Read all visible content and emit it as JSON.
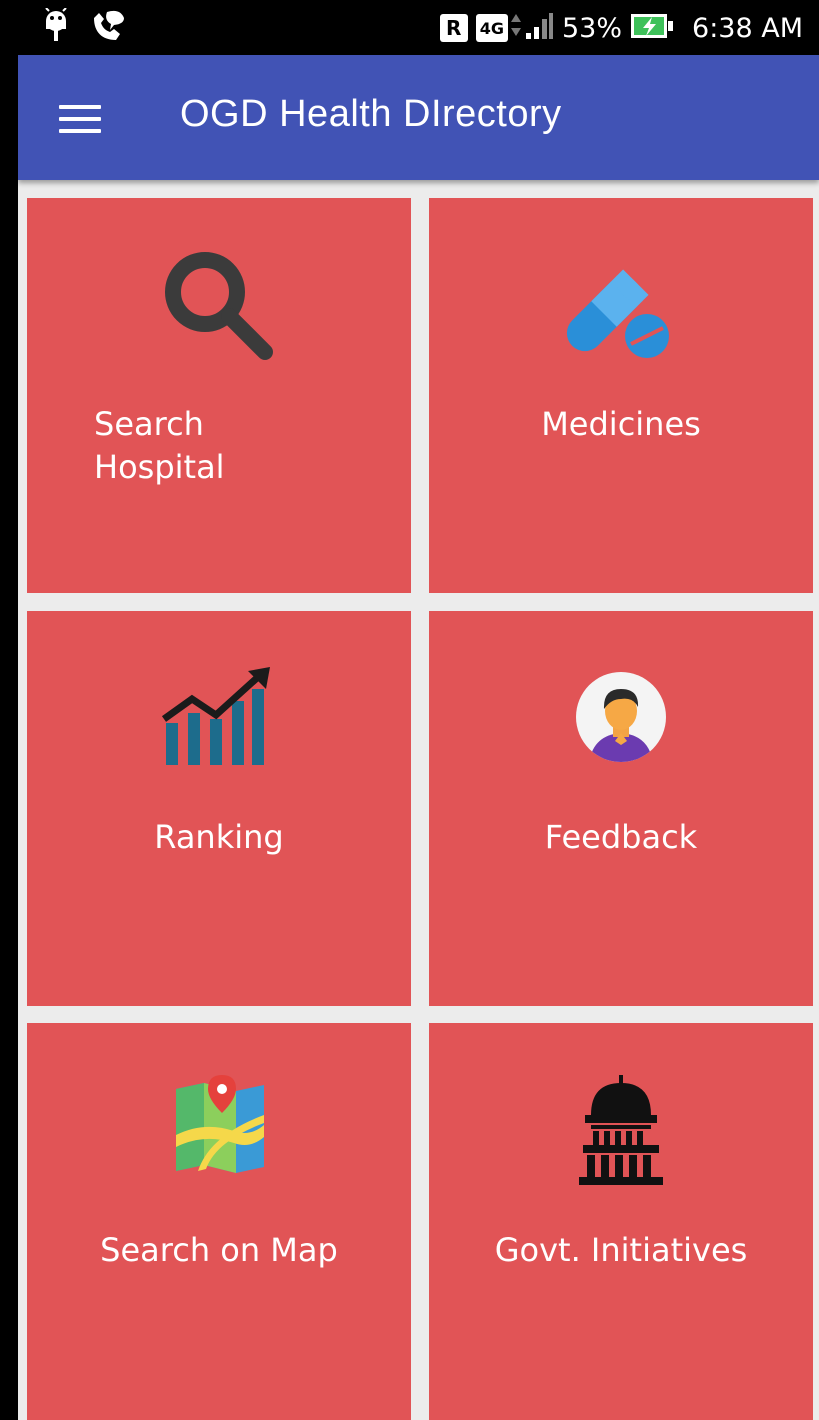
{
  "status_bar": {
    "roaming_badge": "R",
    "network_type": "4G",
    "battery_percent": "53%",
    "time": "6:38 AM",
    "icons": [
      "android-icon",
      "wifi-call-icon",
      "signal-icon",
      "battery-charging-icon"
    ]
  },
  "toolbar": {
    "title": "OGD Health DIrectory",
    "menu_icon": "hamburger-menu-icon"
  },
  "tiles": [
    {
      "label": "Search Hospital",
      "label_line1": "Search",
      "label_line2": "Hospital",
      "icon": "magnifier-icon"
    },
    {
      "label": "Medicines",
      "icon": "pills-icon"
    },
    {
      "label": "Ranking",
      "icon": "bar-chart-trend-icon"
    },
    {
      "label": "Feedback",
      "icon": "user-avatar-icon"
    },
    {
      "label": "Search on Map",
      "icon": "map-pin-icon"
    },
    {
      "label": "Govt. Initiatives",
      "icon": "government-building-icon"
    }
  ],
  "colors": {
    "toolbar": "#4153b5",
    "tile": "#e15456",
    "background": "#ececec"
  }
}
